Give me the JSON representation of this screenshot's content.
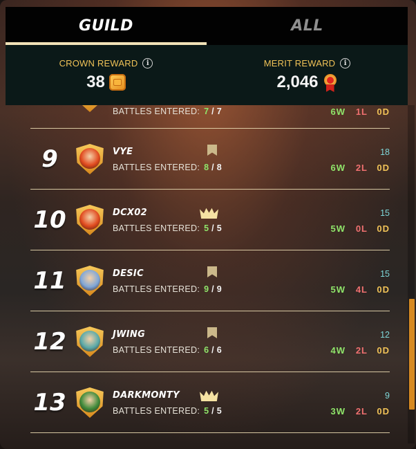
{
  "tabs": [
    {
      "label": "GUILD",
      "active": true
    },
    {
      "label": "ALL",
      "active": false
    }
  ],
  "rewards": {
    "crown": {
      "label": "CROWN REWARD",
      "value": "38",
      "icon": "crown-coin-icon"
    },
    "merit": {
      "label": "MERIT REWARD",
      "value": "2,046",
      "icon": "merit-medal-icon"
    }
  },
  "battles_label": "BATTLES ENTERED:",
  "partial_row": {
    "battles": "7",
    "total": "7",
    "w": "6W",
    "l": "1L",
    "d": "0D"
  },
  "rows": [
    {
      "rank": "9",
      "name": "VYE",
      "role": "member",
      "battles": "8",
      "total": "8",
      "score": "18",
      "w": "6W",
      "l": "2L",
      "d": "0D",
      "avatar_color": "#e14a1e"
    },
    {
      "rank": "10",
      "name": "DCX02",
      "role": "leader",
      "battles": "5",
      "total": "5",
      "score": "15",
      "w": "5W",
      "l": "0L",
      "d": "0D",
      "avatar_color": "#e14a1e"
    },
    {
      "rank": "11",
      "name": "DESIC",
      "role": "member",
      "battles": "9",
      "total": "9",
      "score": "15",
      "w": "5W",
      "l": "4L",
      "d": "0D",
      "avatar_color": "#7fa6d8"
    },
    {
      "rank": "12",
      "name": "JWING",
      "role": "member",
      "battles": "6",
      "total": "6",
      "score": "12",
      "w": "4W",
      "l": "2L",
      "d": "0D",
      "avatar_color": "#5aa9a8"
    },
    {
      "rank": "13",
      "name": "DARKMONTY",
      "role": "leader",
      "battles": "5",
      "total": "5",
      "score": "9",
      "w": "3W",
      "l": "2L",
      "d": "0D",
      "avatar_color": "#3f8a3a"
    }
  ],
  "colors": {
    "win": "#8fe46a",
    "loss": "#f07070",
    "draw": "#f0c257",
    "score": "#7ed7d9",
    "accent": "#f0c257"
  }
}
